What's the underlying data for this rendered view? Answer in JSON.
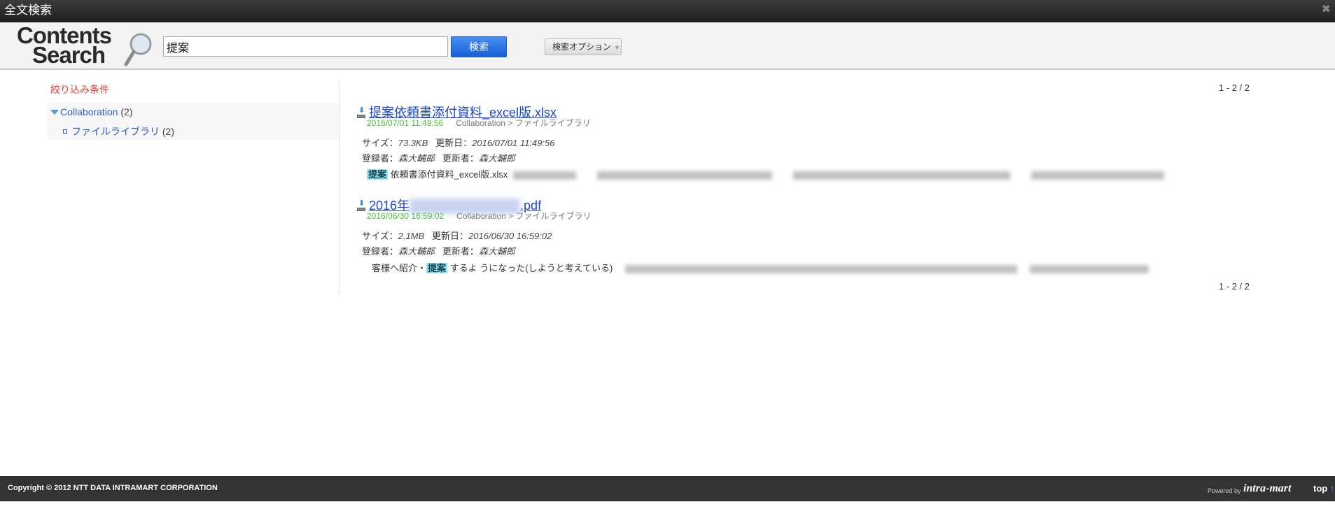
{
  "window": {
    "title": "全文検索"
  },
  "header": {
    "logo_line1": "Contents",
    "logo_line2": "Search",
    "search_value": "提案",
    "search_button": "検索",
    "options_button": "検索オプション"
  },
  "sidebar": {
    "title": "絞り込み条件",
    "items": [
      {
        "label": "Collaboration",
        "count": "(2)"
      },
      {
        "label": "ファイルライブラリ",
        "count": "(2)"
      }
    ]
  },
  "pager": {
    "top": "1 - 2 / 2",
    "bottom": "1 - 2 / 2"
  },
  "results": [
    {
      "title": "提案依頼書添付資料_excel版.xlsx",
      "date": "2016/07/01 11:49:56",
      "path": "Collaboration > ファイルライブラリ",
      "size_label": "サイズ：",
      "size": "73.3KB",
      "updated_label": "更新日：",
      "updated": "2016/07/01 11:49:56",
      "registrant_label": "登録者：",
      "registrant": "森大輔郎",
      "updater_label": "更新者：",
      "updater": "森大輔郎",
      "snippet_pre": "",
      "snippet_hl": "提案",
      "snippet_post": "依頼書添付資料_excel版.xlsx"
    },
    {
      "title_pre": "2016年",
      "title_post": ".pdf",
      "date": "2016/06/30 16:59:02",
      "path": "Collaboration > ファイルライブラリ",
      "size_label": "サイズ：",
      "size": "2.1MB",
      "updated_label": "更新日：",
      "updated": "2016/06/30 16:59:02",
      "registrant_label": "登録者：",
      "registrant": "森大輔郎",
      "updater_label": "更新者：",
      "updater": "森大輔郎",
      "snippet_pre": "客様へ紹介・",
      "snippet_hl": "提案",
      "snippet_post": "するよ うになった(しようと考えている)"
    }
  ],
  "footer": {
    "copyright": "Copyright © 2012 NTT DATA INTRAMART CORPORATION",
    "powered": "Powered by",
    "brand": "intra-mart",
    "top": "top",
    "top_arrow": "↑"
  }
}
